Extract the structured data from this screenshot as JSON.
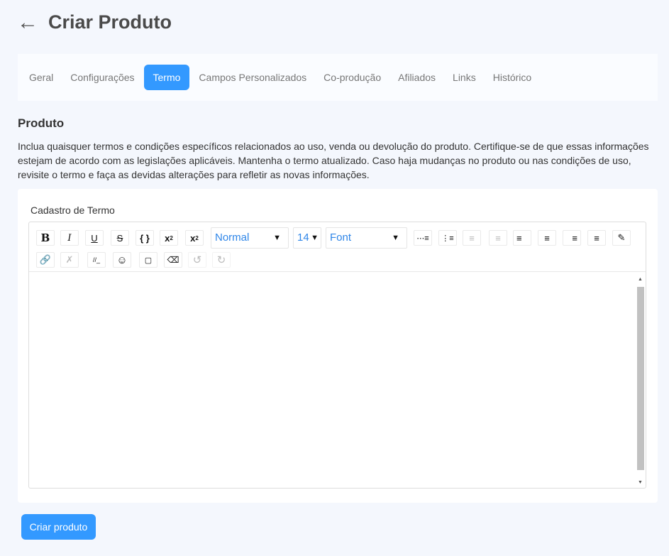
{
  "header": {
    "title": "Criar Produto"
  },
  "tabs": [
    {
      "label": "Geral"
    },
    {
      "label": "Configurações"
    },
    {
      "label": "Termo",
      "active": true
    },
    {
      "label": "Campos Personalizados"
    },
    {
      "label": "Co-produção"
    },
    {
      "label": "Afiliados"
    },
    {
      "label": "Links"
    },
    {
      "label": "Histórico"
    }
  ],
  "section": {
    "title": "Produto",
    "description": "Inclua quaisquer termos e condições específicos relacionados ao uso, venda ou devolução do produto. Certifique-se de que essas informações estejam de acordo com as legislações aplicáveis. Mantenha o termo atualizado. Caso haja mudanças no produto ou nas condições de uso, revisite o termo e faça as devidas alterações para refletir as novas informações."
  },
  "editor": {
    "label": "Cadastro de Termo",
    "heading_select": "Normal",
    "size_select": "14",
    "font_select": "Font",
    "content": ""
  },
  "submit_label": "Criar produto",
  "colors": {
    "accent": "#3399ff",
    "background": "#f4f7fd"
  }
}
